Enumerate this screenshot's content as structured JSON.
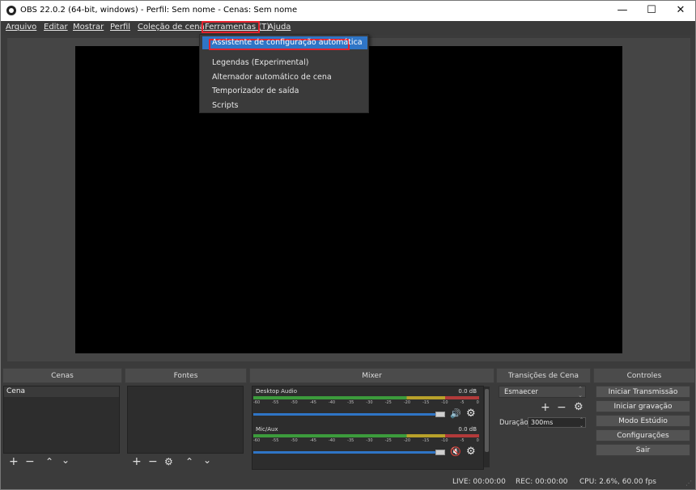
{
  "window": {
    "title": "OBS 22.0.2 (64-bit, windows) - Perfil: Sem nome - Cenas: Sem nome",
    "controls": {
      "minimize": "—",
      "maximize": "☐",
      "close": "✕"
    }
  },
  "menubar": {
    "items": [
      "Arquivo",
      "Editar",
      "Mostrar",
      "Perfil",
      "Coleção de cena",
      "Ferramentas (T)",
      "Ajuda"
    ]
  },
  "tools_menu": {
    "selected": "Assistente de configuração automática",
    "items": [
      "Legendas (Experimental)",
      "Alternador automático de cena",
      "Temporizador de saída",
      "Scripts"
    ]
  },
  "docks": {
    "scenes": {
      "title": "Cenas",
      "items": [
        "Cena"
      ]
    },
    "sources": {
      "title": "Fontes"
    },
    "mixer": {
      "title": "Mixer",
      "channels": [
        {
          "name": "Desktop Audio",
          "db": "0.0 dB",
          "level": 0.95,
          "muted": false
        },
        {
          "name": "Mic/Aux",
          "db": "0.0 dB",
          "level": 0.95,
          "muted": true
        }
      ],
      "scale": [
        "-60",
        "-55",
        "-50",
        "-45",
        "-40",
        "-35",
        "-30",
        "-25",
        "-20",
        "-15",
        "-10",
        "-5",
        "0"
      ]
    },
    "transitions": {
      "title": "Transições de Cena",
      "selected": "Esmaecer",
      "duration_label": "Duração",
      "duration_value": "300ms"
    },
    "controls": {
      "title": "Controles",
      "buttons": [
        "Iniciar Transmissão",
        "Iniciar gravação",
        "Modo Estúdio",
        "Configurações",
        "Sair"
      ]
    }
  },
  "status": {
    "live": "LIVE: 00:00:00",
    "rec": "REC: 00:00:00",
    "cpu": "CPU: 2.6%, 60.00 fps"
  },
  "colors": {
    "highlight": "#e3232e",
    "selection": "#2f75c6",
    "background": "#3b3b3b"
  }
}
